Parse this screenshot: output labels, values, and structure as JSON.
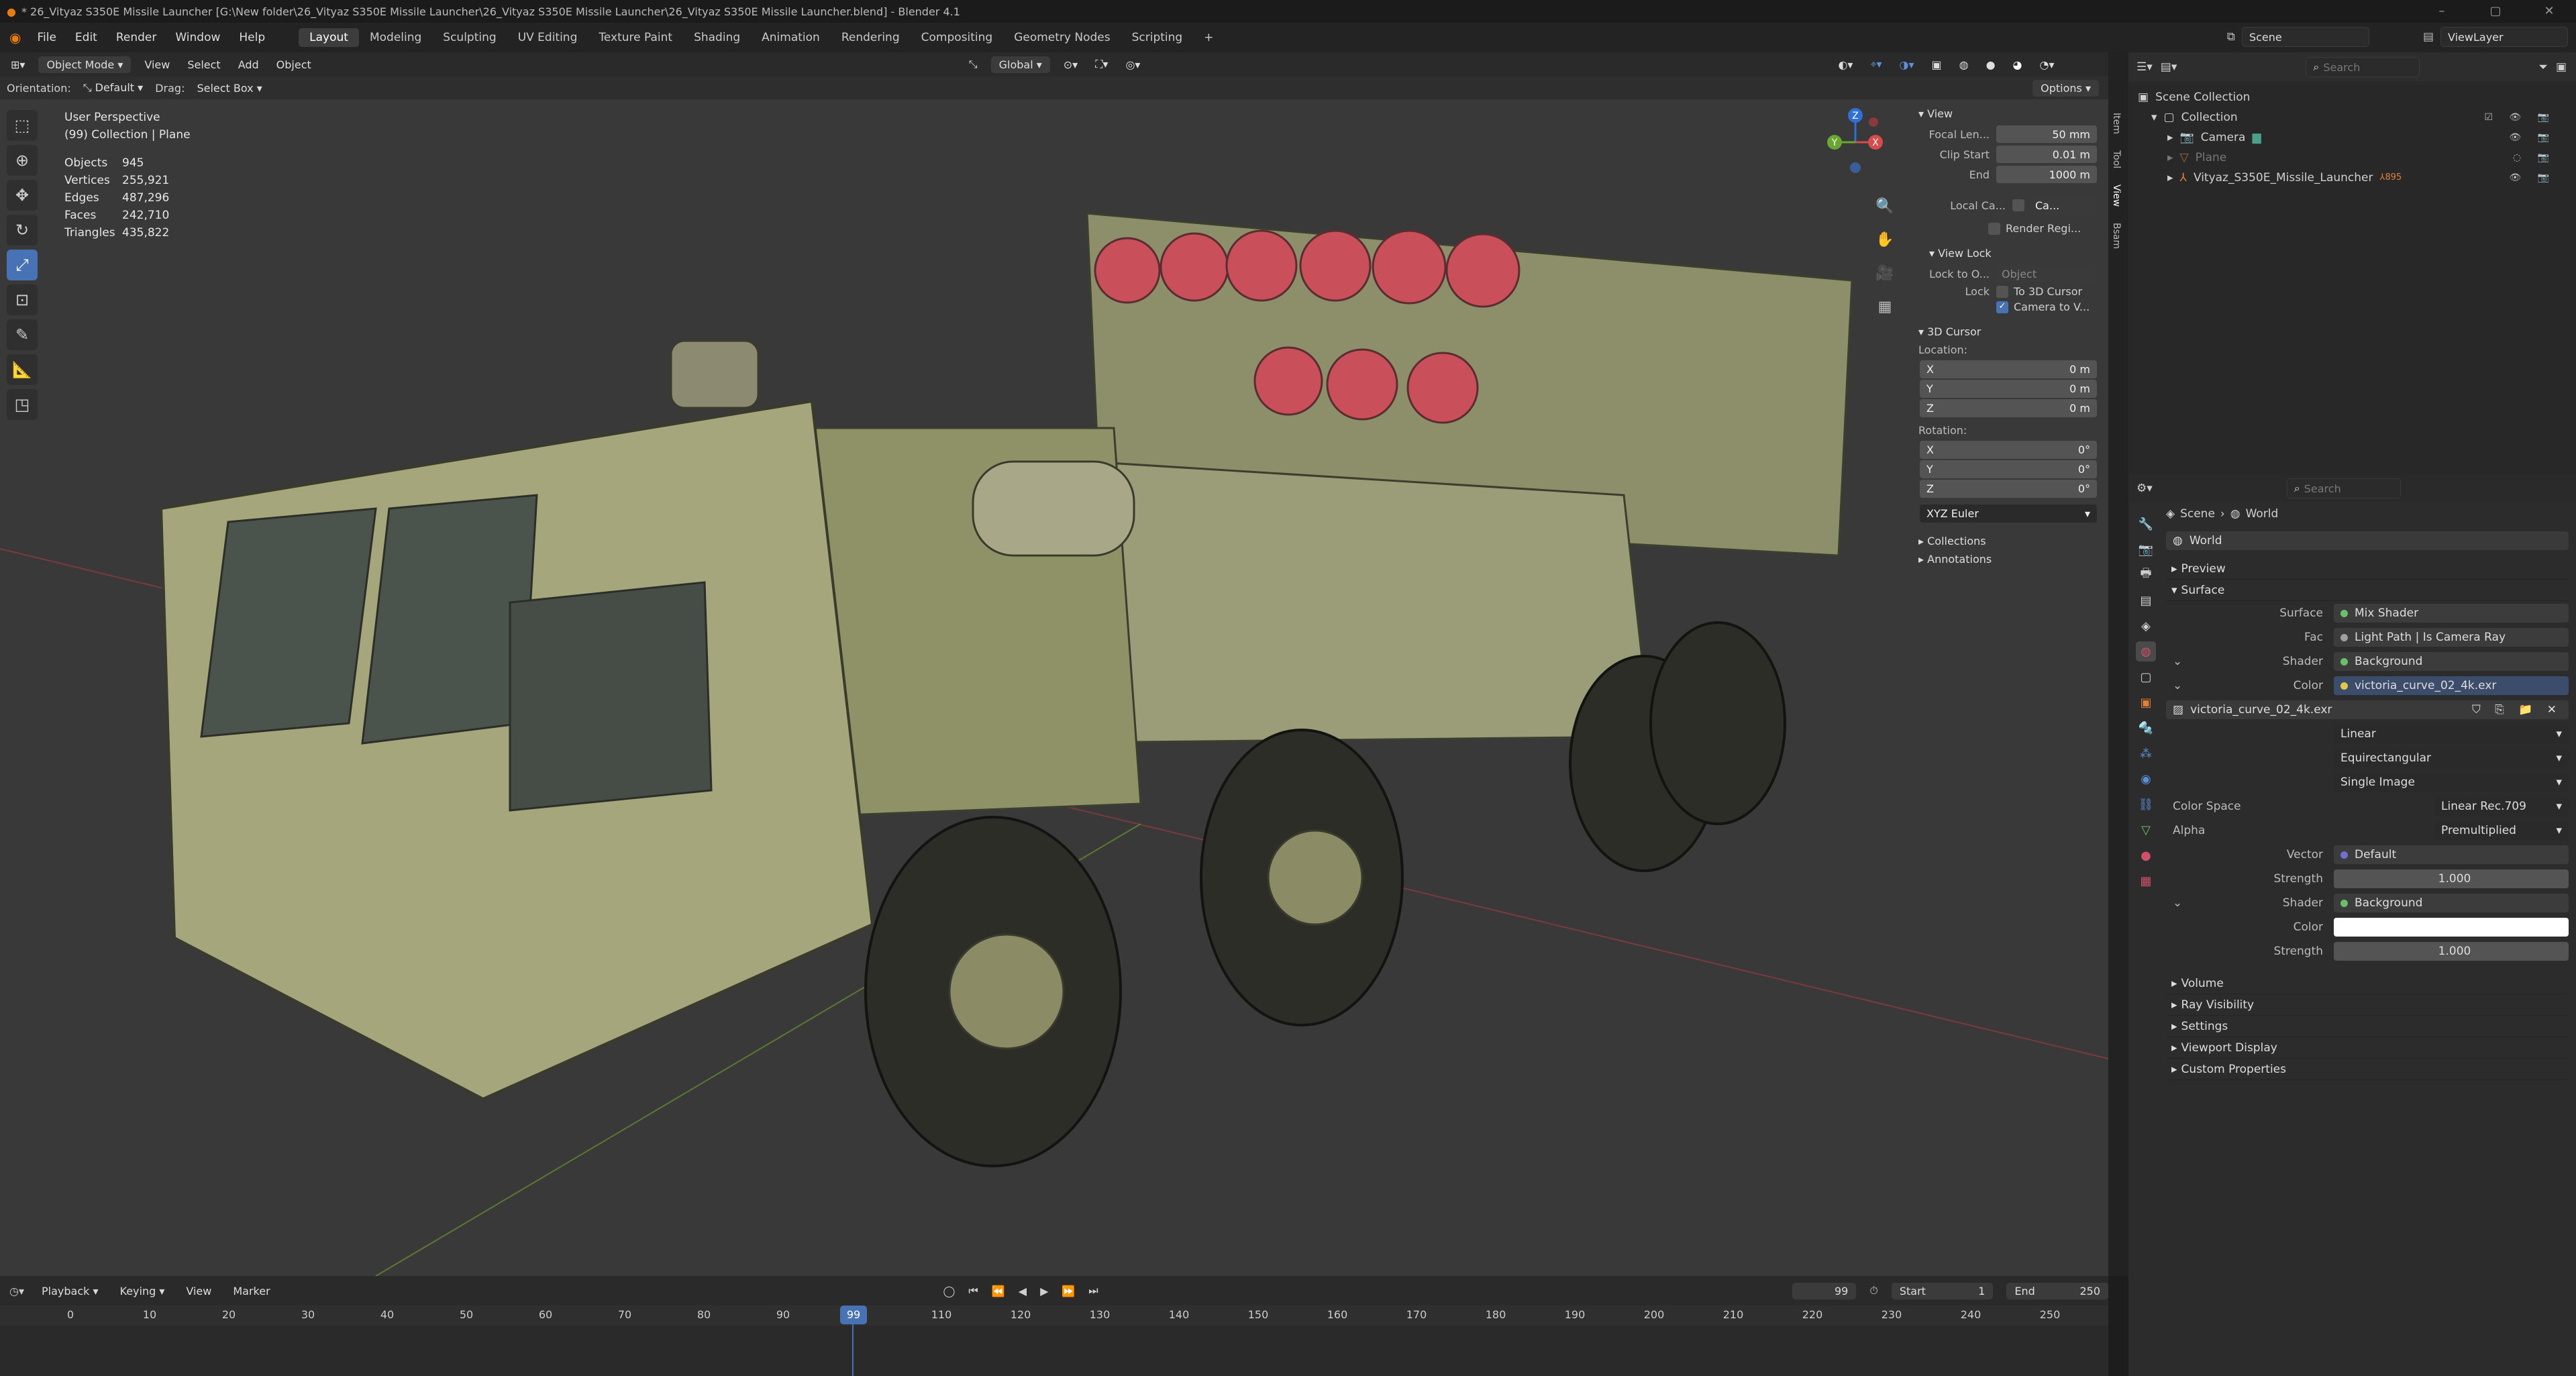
{
  "window": {
    "title": "* 26_Vityaz S350E Missile Launcher [G:\\New folder\\26_Vityaz S350E Missile Launcher\\26_Vityaz S350E Missile Launcher\\26_Vityaz S350E Missile Launcher.blend] - Blender 4.1"
  },
  "menus": [
    "File",
    "Edit",
    "Render",
    "Window",
    "Help"
  ],
  "workspaces": [
    "Layout",
    "Modeling",
    "Sculpting",
    "UV Editing",
    "Texture Paint",
    "Shading",
    "Animation",
    "Rendering",
    "Compositing",
    "Geometry Nodes",
    "Scripting"
  ],
  "scene": {
    "name": "Scene",
    "view_layer": "ViewLayer"
  },
  "viewport": {
    "mode": "Object Mode",
    "menus": [
      "View",
      "Select",
      "Add",
      "Object"
    ],
    "transform": "Global",
    "orientation_label": "Orientation:",
    "orientation": "Default",
    "drag_label": "Drag:",
    "drag": "Select Box",
    "options": "Options",
    "perspective": "User Perspective",
    "collection_line": "(99) Collection | Plane",
    "stats": [
      {
        "k": "Objects",
        "v": "945"
      },
      {
        "k": "Vertices",
        "v": "255,921"
      },
      {
        "k": "Edges",
        "v": "487,296"
      },
      {
        "k": "Faces",
        "v": "242,710"
      },
      {
        "k": "Triangles",
        "v": "435,822"
      }
    ],
    "gizmo": {
      "x": "X",
      "y": "Y",
      "z": "Z"
    }
  },
  "npanel": {
    "tabs": [
      "Item",
      "Tool",
      "View",
      "Bsam"
    ],
    "view_section": "View",
    "focal_label": "Focal Len...",
    "focal": "50 mm",
    "clip_start_label": "Clip Start",
    "clip_start": "0.01 m",
    "end_label": "End",
    "end": "1000 m",
    "local_cam_label": "Local Ca...",
    "local_cam": "Ca...",
    "render_region": "Render Regi...",
    "view_lock": "View Lock",
    "lock_to_label": "Lock to O...",
    "lock_to": "Object",
    "lock_label": "Lock",
    "to_cursor": "To 3D Cursor",
    "cam_to_view": "Camera to V...",
    "cursor_section": "3D Cursor",
    "location_label": "Location:",
    "loc": [
      {
        "a": "X",
        "v": "0 m"
      },
      {
        "a": "Y",
        "v": "0 m"
      },
      {
        "a": "Z",
        "v": "0 m"
      }
    ],
    "rotation_label": "Rotation:",
    "rot": [
      {
        "a": "X",
        "v": "0°"
      },
      {
        "a": "Y",
        "v": "0°"
      },
      {
        "a": "Z",
        "v": "0°"
      }
    ],
    "rot_mode": "XYZ Euler",
    "collections": "Collections",
    "annotations": "Annotations"
  },
  "outliner": {
    "search": "Search",
    "root": "Scene Collection",
    "collection": "Collection",
    "items": [
      "Camera",
      "Plane",
      "Vityaz_S350E_Missile_Launcher"
    ],
    "badge": "895"
  },
  "properties": {
    "search": "Search",
    "bc_scene": "Scene",
    "bc_world": "World",
    "world_name": "World",
    "preview": "Preview",
    "surface": "Surface",
    "rows": [
      {
        "l": "Surface",
        "v": "Mix Shader"
      },
      {
        "l": "Fac",
        "v": "Light Path | Is Camera Ray"
      },
      {
        "l": "Shader",
        "v": "Background"
      },
      {
        "l": "Color",
        "v": "victoria_curve_02_4k.exr"
      }
    ],
    "image": "victoria_curve_02_4k.exr",
    "interp": "Linear",
    "proj": "Equirectangular",
    "source": "Single Image",
    "colorspace_label": "Color Space",
    "colorspace": "Linear Rec.709",
    "alpha_label": "Alpha",
    "alpha": "Premultiplied",
    "vector_label": "Vector",
    "vector": "Default",
    "strength_label": "Strength",
    "strength": "1.000",
    "shader2_label": "Shader",
    "shader2": "Background",
    "color2_label": "Color",
    "strength2": "1.000",
    "collapsed": [
      "Volume",
      "Ray Visibility",
      "Settings",
      "Viewport Display",
      "Custom Properties"
    ]
  },
  "timeline": {
    "menus": [
      "Playback",
      "Keying",
      "View",
      "Marker"
    ],
    "current": "99",
    "start_label": "Start",
    "start": "1",
    "end_label": "End",
    "end": "250",
    "ticks": [
      "0",
      "10",
      "20",
      "30",
      "40",
      "50",
      "60",
      "70",
      "80",
      "90",
      "110",
      "120",
      "130",
      "140",
      "150",
      "160",
      "170",
      "180",
      "190",
      "200",
      "210",
      "220",
      "230",
      "240",
      "250"
    ],
    "playhead": "99"
  },
  "colors": {
    "accent": "#4772b3",
    "bg": "#1d1d1d",
    "viewport": "#393939"
  }
}
